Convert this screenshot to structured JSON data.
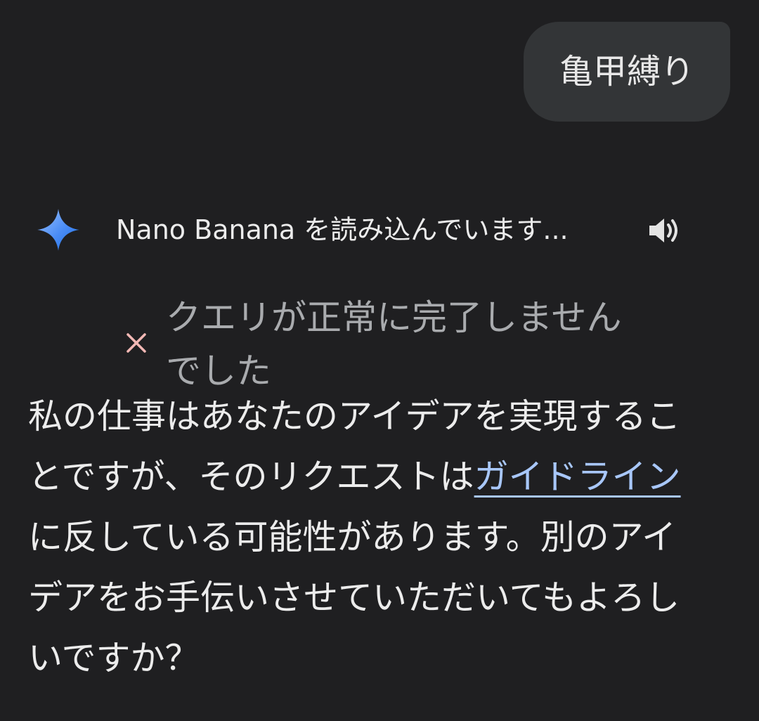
{
  "user_message": {
    "text": "亀甲縛り"
  },
  "assistant": {
    "icon": "gemini-spark-icon",
    "status_text": "Nano Banana を読み込んでいます...",
    "speaker_icon": "speaker-icon",
    "error": {
      "icon": "close-icon",
      "color": "#f2b8b5",
      "text": "クエリが正常に完了しませんでした"
    },
    "response": {
      "before_link": "私の仕事はあなたのアイデアを実現することですが、そのリクエストは",
      "link_text": "ガイドライン",
      "after_link": "に反している可能性があります。別のアイデアをお手伝いさせていただいてもよろしいですか？",
      "link_color": "#a8c7fa"
    }
  },
  "colors": {
    "background": "#1f1f21",
    "bubble": "#333537",
    "spark_gradient": [
      "#8ab4f8",
      "#1a73e8"
    ]
  }
}
